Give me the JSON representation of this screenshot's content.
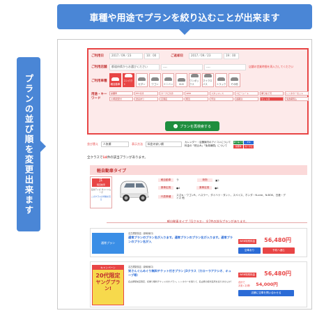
{
  "callouts": {
    "top": "車種や用途でプランを絞り込むことが出来ます",
    "side": "プランの並び順を変更出来ます"
  },
  "search": {
    "row1_label": "ご利用日",
    "row1_date": "2017／09／23",
    "row1_time": "10：00",
    "row1_date2": "2017／09／23",
    "row1_time2": "19：00",
    "return_label": "ご返却日",
    "row2_label": "ご利用店舗",
    "row2_value": "都道府県からお選びください",
    "row2_sel2": "----",
    "row2_sel3": "----",
    "row2_note": "店舗の営業時間を再入力してください",
    "car_label": "ご利用車種",
    "cars": [
      {
        "name": "軽自動車",
        "selected": true
      },
      {
        "name": "コンパクト",
        "selected": true
      },
      {
        "name": "セダン",
        "selected": false
      },
      {
        "name": "ワゴン",
        "selected": false
      },
      {
        "name": "ミニバン",
        "selected": false
      },
      {
        "name": "SUV",
        "selected": false
      },
      {
        "name": "ワンボックス",
        "selected": false
      },
      {
        "name": "マイクロバス",
        "selected": false
      },
      {
        "name": "トラック",
        "selected": false
      },
      {
        "name": "その他",
        "selected": false
      }
    ],
    "kw_label": "用途・キーワード",
    "keywords": [
      {
        "text": "禁煙車",
        "on": false
      },
      {
        "text": "ETC付き",
        "on": false
      },
      {
        "text": "カーナビ付き",
        "on": false
      },
      {
        "text": "4WD",
        "on": false
      },
      {
        "text": "スタッドレス",
        "on": false
      },
      {
        "text": "ベビーシート",
        "on": false
      },
      {
        "text": "乗り捨て可",
        "on": false
      },
      {
        "text": "レンタカーセット",
        "on": false
      },
      {
        "text": "24時間受付",
        "on": false
      },
      {
        "text": "送迎あり",
        "on": false
      },
      {
        "text": "空港店",
        "on": false
      },
      {
        "text": "駅近",
        "on": false
      },
      {
        "text": "早割",
        "on": false
      },
      {
        "text": "長期割",
        "on": false
      },
      {
        "text": "セット割",
        "on": true
      },
      {
        "text": "免責補償込",
        "on": false
      }
    ],
    "button_label": "プランを再検索する"
  },
  "sort": {
    "sort_label": "並び替え",
    "sort_value": "人気順",
    "tenpo_label": "表示方法",
    "tenpo_value": "料金の安い順",
    "legend1": "カレンダー・店舗案内のアイコンについて",
    "legend2": "料金の「税込み」「免責補償」について",
    "tag1": "乗り捨て可",
    "tag2": "ETC",
    "tag3": "禁煙車",
    "tag4": "カーナビ"
  },
  "count": {
    "prefix": "全クラスで",
    "num": "14",
    "suffix": "件の該当プランがあります。"
  },
  "category": {
    "title": "軽自動車タイプ"
  },
  "classcard": {
    "code": "J1",
    "code_sub": "軽自動車",
    "sub": "日産デイズ ダイハツムーヴ",
    "link": "このクラスの車種を見る",
    "spec_capacity_label": "乗車定員",
    "spec_capacity_value": "4",
    "spec_luggage_label": "荷物",
    "spec_luggage_value": "2",
    "spec_doors_label": "乗車定員",
    "spec_doors_value": "4",
    "spec_models_label": "代表車種",
    "spec_models_value": "スズキ・ワゴンR、ハスラー、ダイハツ・タント、スペイス、ホンダ・N-one、N-BOX、日産・デイズ 他",
    "class_label": "軽自動車",
    "rank": "ラ"
  },
  "subhead": {
    "text": "軽自動車タイプ「J1クラス」 全7件の該当プランがあります。"
  },
  "plan1": {
    "img_label": "通常プラン",
    "shop": "名古屋駅前店（新幹線口）",
    "title": "通常プランのプラン名が入ります。通常プランのプラン名が入ります。通常プランのプラン名が入",
    "web": "WEB特別料金",
    "price": "56,480円",
    "btn1": "空車あり",
    "btn2": "予約へ進む"
  },
  "plan2": {
    "campaign_head": "キャンペーン",
    "campaign_big": "20代限定",
    "campaign_big2": "ヤングプラン!",
    "shop": "名古屋駅前店（新幹線口）",
    "title": "栄さんぐんめぐり無料チケット付きプラン J3クラス（カローラアクシオ、キューブ等）",
    "desc": "名古屋駅前店限定、初乗り無料チケット付きプラン。レンタカーを借りて、名古屋の観光名所を巡りませんか？",
    "web": "WEB特別料金",
    "price": "56,480円",
    "extra_label": "合計で",
    "extra_label2": "お安くお得!",
    "extra_price": "54,000円",
    "btn": "店舗に空車を問い合わせる"
  }
}
